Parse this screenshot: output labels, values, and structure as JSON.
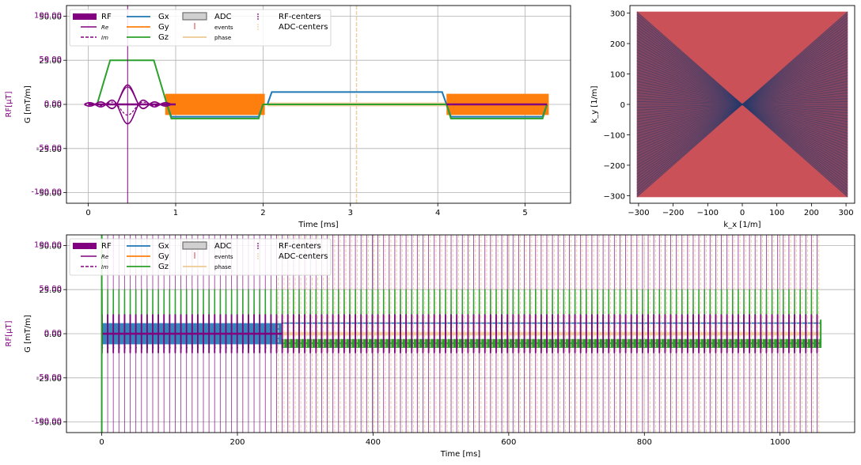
{
  "colors": {
    "rf": "#800080",
    "gx": "#1f77b4",
    "gy": "#ff7f0e",
    "gz": "#2ca02c",
    "adc_phase": "#f0d0a0",
    "kspace_line": "#2a3a6a",
    "kspace_dot": "#c84850",
    "grid": "#b0b0b0",
    "text": "#000000"
  },
  "legend": {
    "rf": "RF",
    "re": "Re",
    "im": "Im",
    "gx": "Gx",
    "gy": "Gy",
    "gz": "Gz",
    "adc": "ADC",
    "events": "events",
    "phase": "phase",
    "rf_centers": "RF-centers",
    "adc_centers": "ADC-centers"
  },
  "chart_data": [
    {
      "type": "line",
      "xlabel": "Time [ms]",
      "ylabel_gradient": "G [mT/m]",
      "ylabel_rf": "RF[μT]",
      "xlim": [
        -0.25,
        5.52
      ],
      "xticks": [
        0,
        1,
        2,
        3,
        4,
        5
      ],
      "ylim_gradient": [
        -56,
        56
      ],
      "yticks_gradient": [
        "50.00",
        "25.00",
        "0.00",
        "-25.00",
        "-50.00"
      ],
      "ylim_rf": [
        -112,
        112
      ],
      "yticks_rf": [
        "100.00",
        "50.00",
        "0.00",
        "-50.00",
        "-100.00"
      ],
      "rf_center_ms": 0.45,
      "adc_center_ms": 3.07,
      "gz_trapezoid": {
        "start": 0.1,
        "ramp_up_end": 0.25,
        "flat_end": 0.75,
        "end": 0.9,
        "amplitude": 25
      },
      "gx_prephaser": {
        "start": 0.9,
        "end": 2.0,
        "amplitude": -7
      },
      "gz_rephaser": {
        "start": 0.9,
        "end": 2.0,
        "amplitude": -8
      },
      "gx_readout": {
        "start": 2.05,
        "end": 4.1,
        "amplitude": 7
      },
      "gx_rewinder": {
        "start": 4.1,
        "end": 5.25,
        "amplitude": -7
      },
      "gz_spoiler": {
        "start": 4.1,
        "end": 5.25,
        "amplitude": -8
      },
      "gy_blocks": [
        {
          "start": 0.88,
          "end": 2.02,
          "amplitude": 6
        },
        {
          "start": 4.1,
          "end": 5.27,
          "amplitude": 6
        }
      ],
      "adc_window": {
        "start": 2.05,
        "end": 4.1
      }
    },
    {
      "type": "scatter",
      "xlabel": "k_x [1/m]",
      "ylabel": "k_y [1/m]",
      "xlim": [
        -325,
        325
      ],
      "ylim": [
        -325,
        325
      ],
      "xticks": [
        -300,
        -200,
        -100,
        0,
        100,
        200,
        300
      ],
      "yticks": [
        300,
        200,
        100,
        0,
        -100,
        -200,
        -300
      ],
      "kmax": 305
    },
    {
      "type": "line",
      "xlabel": "Time [ms]",
      "ylabel_gradient": "G [mT/m]",
      "ylabel_rf": "RF[μT]",
      "xlim": [
        -52,
        1110
      ],
      "xticks": [
        0,
        200,
        400,
        600,
        800,
        1000
      ],
      "ylim_gradient": [
        -56,
        56
      ],
      "yticks_gradient": [
        "50.00",
        "25.00",
        "0.00",
        "-25.00",
        "-50.00"
      ],
      "ylim_rf": [
        -112,
        112
      ],
      "yticks_rf": [
        "100.00",
        "50.00",
        "0.00",
        "-50.00",
        "-100.00"
      ],
      "n_repetitions": 128,
      "tr_ms": 8.3,
      "dummy_end_ms": 265,
      "seq_end_ms": 1060
    }
  ]
}
